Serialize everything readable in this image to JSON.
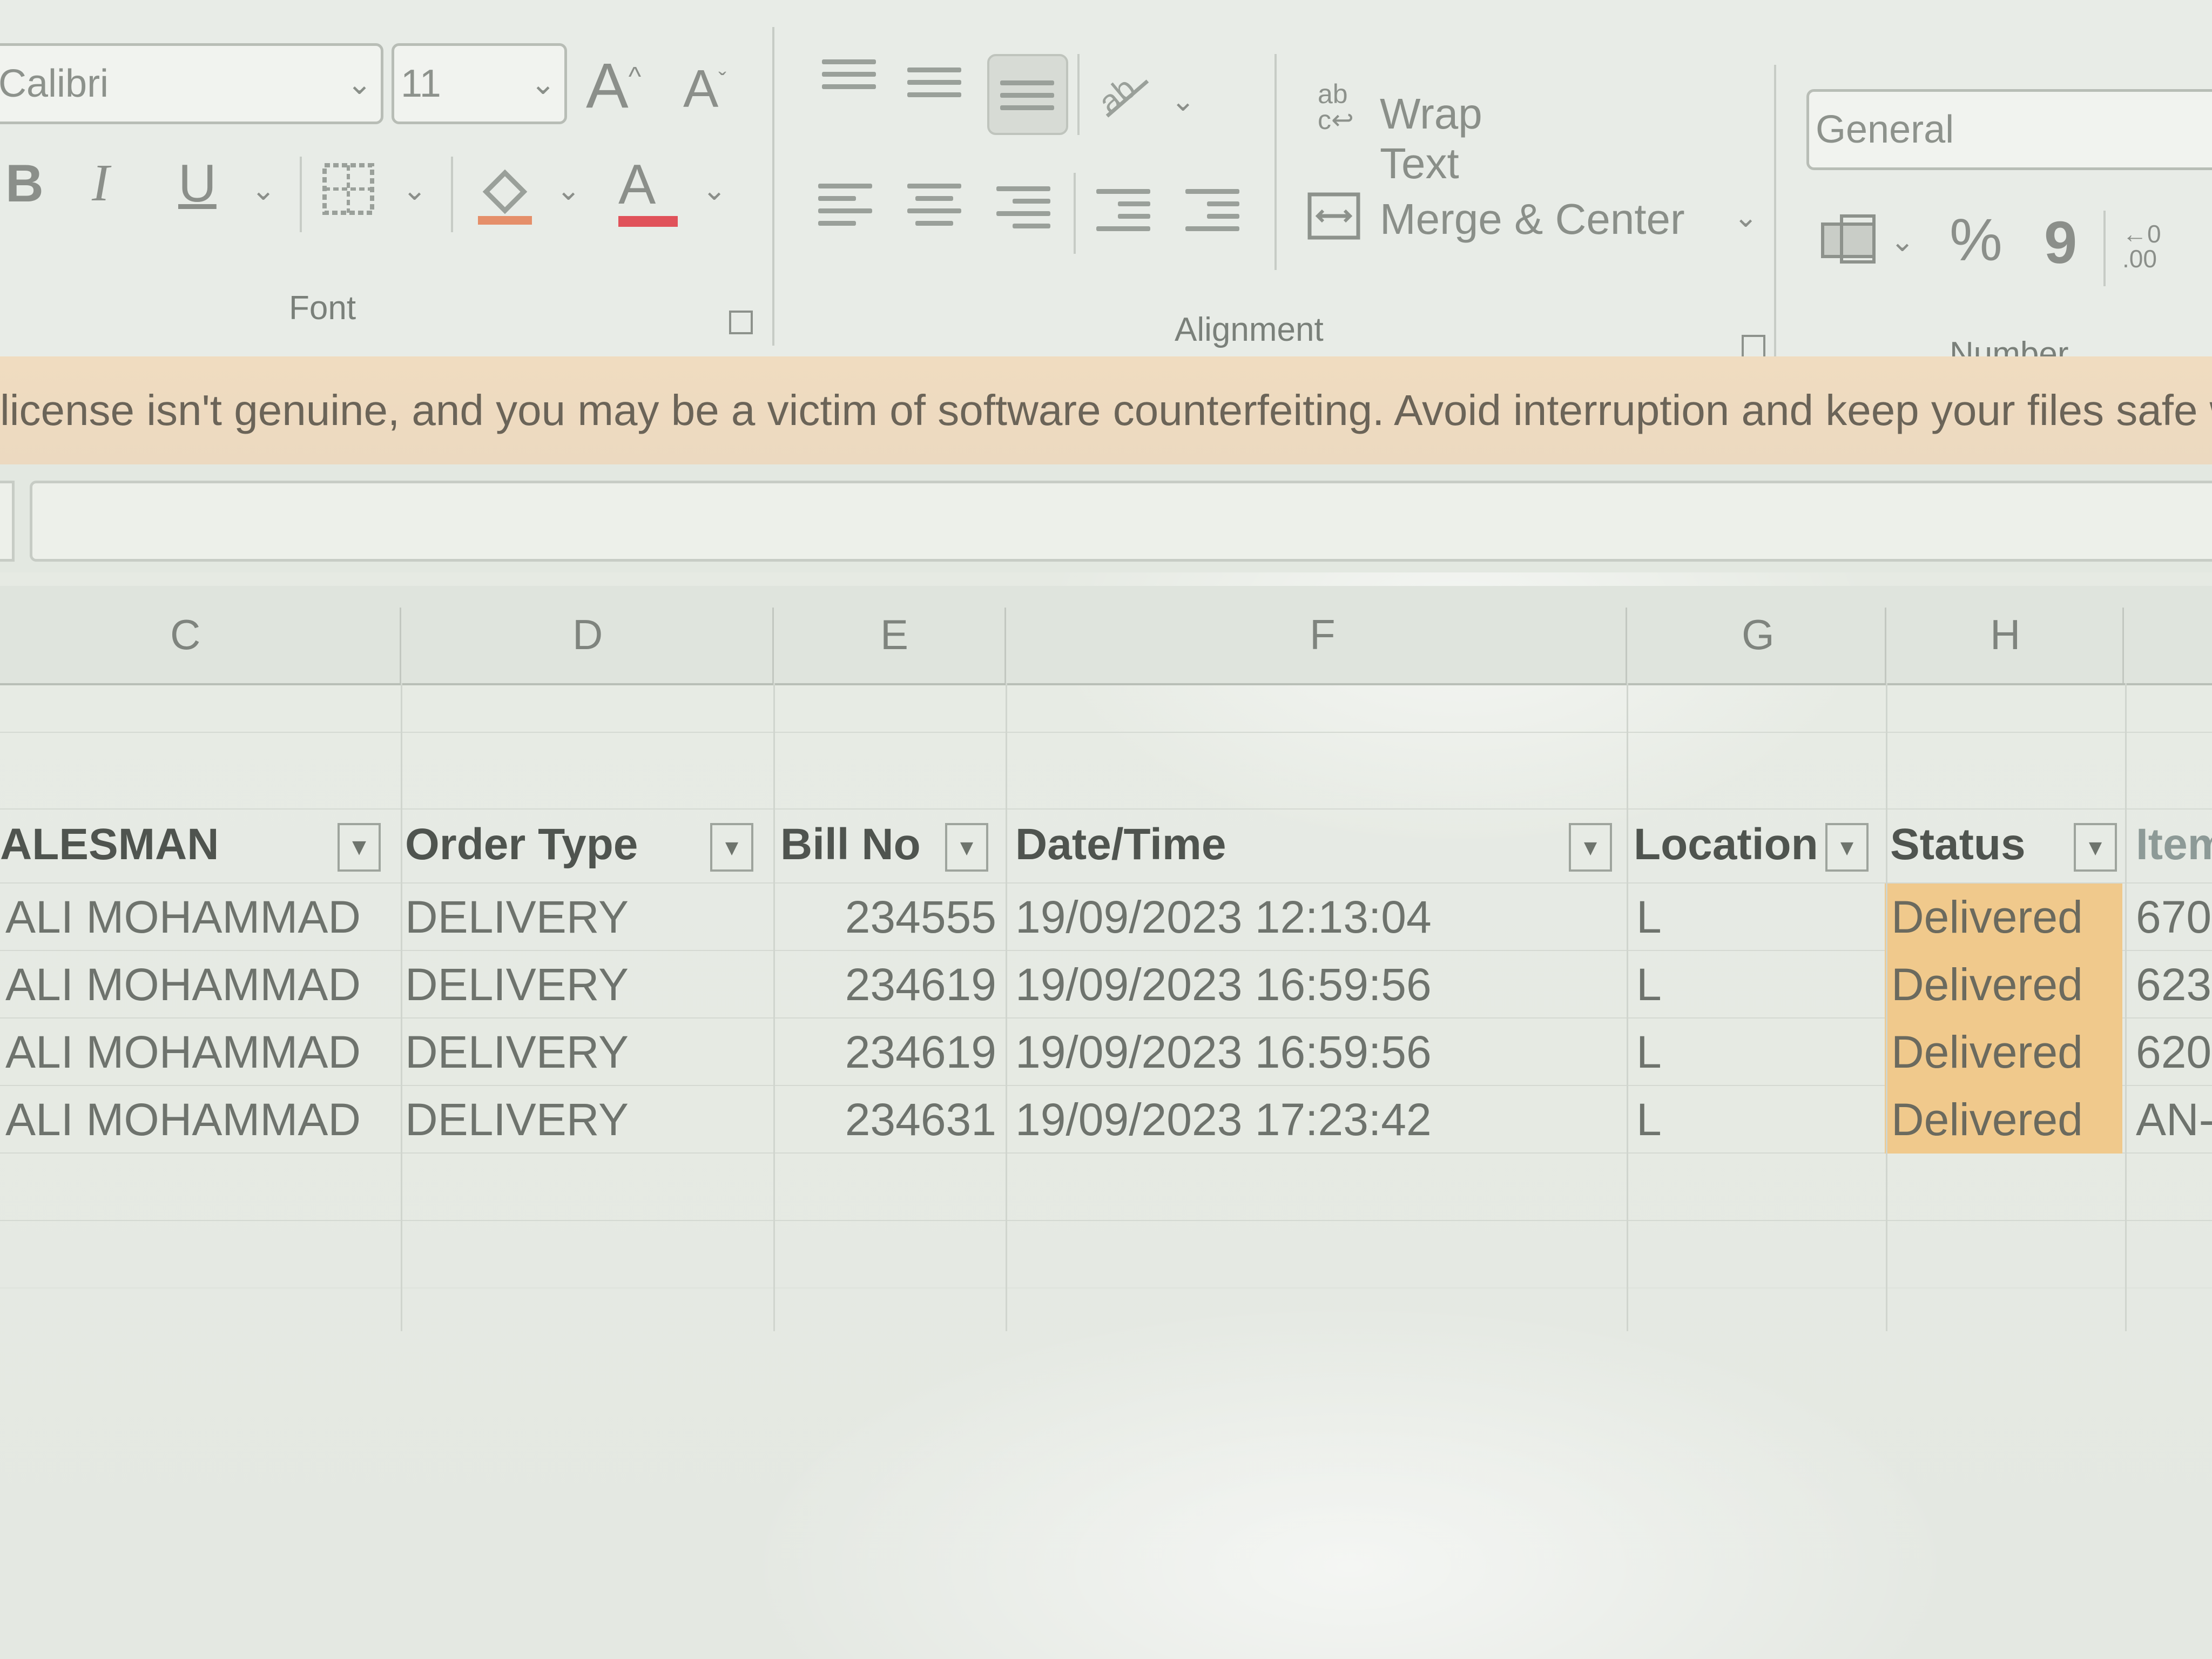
{
  "ribbon": {
    "font_name": "Calibri",
    "font_size": "11",
    "bold_label": "B",
    "italic_label": "I",
    "underline_label": "U",
    "grow_font_label": "A",
    "shrink_font_label": "A",
    "font_color_label": "A",
    "font_group_label": "Font",
    "wrap_text_label": "Wrap Text",
    "merge_center_label": "Merge & Center",
    "alignment_group_label": "Alignment",
    "number_format": "General",
    "percent_label": "%",
    "comma_label": "9",
    "number_group_label": "Number"
  },
  "warning": {
    "text": "license isn't genuine, and you may be a victim of software counterfeiting. Avoid interruption and keep your files safe with"
  },
  "columns": [
    "C",
    "D",
    "E",
    "F",
    "G",
    "H"
  ],
  "table": {
    "headers": [
      "ALESMAN",
      "Order Type",
      "Bill No",
      "Date/Time",
      "Location",
      "Status",
      "Item"
    ],
    "rows": [
      [
        "ALI MOHAMMAD",
        "DELIVERY",
        "234555",
        "19/09/2023 12:13:04",
        "L",
        "Delivered",
        "670"
      ],
      [
        "ALI MOHAMMAD",
        "DELIVERY",
        "234619",
        "19/09/2023 16:59:56",
        "L",
        "Delivered",
        "623"
      ],
      [
        "ALI MOHAMMAD",
        "DELIVERY",
        "234619",
        "19/09/2023 16:59:56",
        "L",
        "Delivered",
        "620"
      ],
      [
        "ALI MOHAMMAD",
        "DELIVERY",
        "234631",
        "19/09/2023 17:23:42",
        "L",
        "Delivered",
        "AN-"
      ]
    ]
  },
  "colors": {
    "status_fill": "#f0c98c",
    "warning_fill": "#f0dcc0"
  }
}
